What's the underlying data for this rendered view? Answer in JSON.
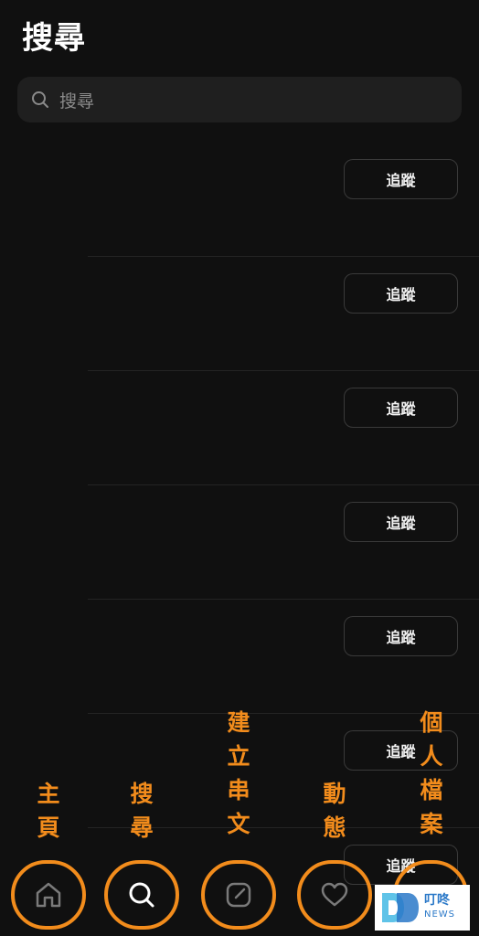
{
  "header": {
    "title": "搜尋"
  },
  "search": {
    "placeholder": "搜尋"
  },
  "suggestions": {
    "follow_label": "追蹤",
    "count": 7
  },
  "bottom_nav": {
    "items": [
      {
        "label_chars": [
          "主",
          "頁"
        ],
        "icon": "home-icon"
      },
      {
        "label_chars": [
          "搜",
          "尋"
        ],
        "icon": "search-icon"
      },
      {
        "label_chars": [
          "建",
          "立",
          "串",
          "文"
        ],
        "icon": "compose-icon"
      },
      {
        "label_chars": [
          "動",
          "態"
        ],
        "icon": "heart-icon"
      },
      {
        "label_chars": [
          "個",
          "人",
          "檔",
          "案"
        ],
        "icon": "profile-icon"
      }
    ]
  },
  "watermark": {
    "name": "叮咚",
    "sub": "NEWS"
  },
  "colors": {
    "accent": "#f28c1c",
    "background": "#101010",
    "watermark": "#2a78c8"
  }
}
